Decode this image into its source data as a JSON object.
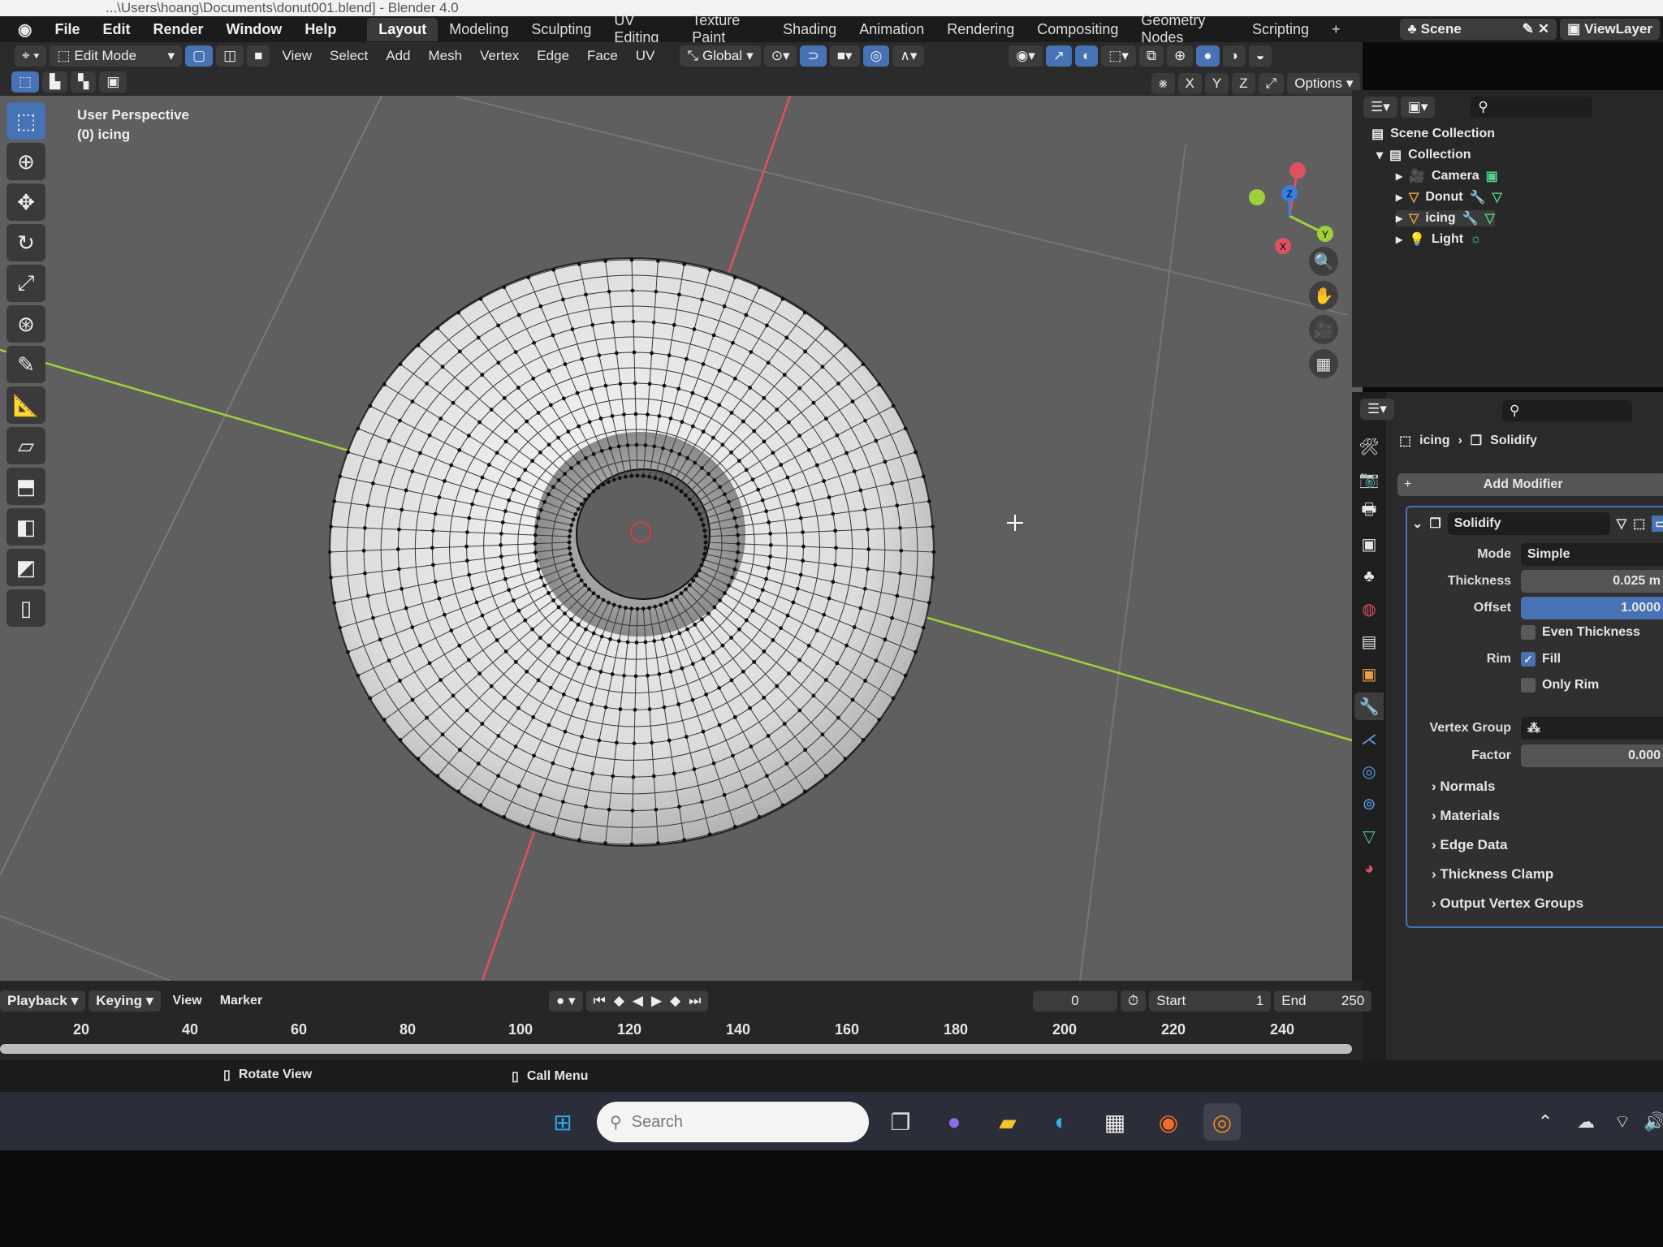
{
  "window": {
    "title": "...\\Users\\hoang\\Documents\\donut001.blend] - Blender 4.0"
  },
  "menubar": {
    "items": [
      "File",
      "Edit",
      "Render",
      "Window",
      "Help"
    ],
    "workspaces": [
      "Layout",
      "Modeling",
      "Sculpting",
      "UV Editing",
      "Texture Paint",
      "Shading",
      "Animation",
      "Rendering",
      "Compositing",
      "Geometry Nodes",
      "Scripting",
      "+"
    ],
    "active_workspace": "Layout",
    "scene": "Scene",
    "view_layer": "ViewLayer"
  },
  "header": {
    "mode": "Edit Mode",
    "menus": [
      "View",
      "Select",
      "Add",
      "Mesh",
      "Vertex",
      "Edge",
      "Face",
      "UV"
    ],
    "orientation": "Global",
    "axes": [
      "X",
      "Y",
      "Z"
    ],
    "options": "Options"
  },
  "viewport": {
    "view_name": "User Perspective",
    "object_label": "(0) icing",
    "gizmo_axes": [
      "X",
      "Y",
      "Z"
    ],
    "colors": {
      "x_axis": "#e05060",
      "y_axis": "#9fd03a",
      "z_axis": "#3a7ce0",
      "selection": "#4772b3"
    }
  },
  "outliner": {
    "root": "Scene Collection",
    "collection": "Collection",
    "items": [
      {
        "name": "Camera",
        "icon": "camera-icon"
      },
      {
        "name": "Donut",
        "icon": "mesh-icon"
      },
      {
        "name": "icing",
        "icon": "mesh-icon"
      },
      {
        "name": "Light",
        "icon": "light-icon"
      }
    ]
  },
  "properties": {
    "breadcrumb": {
      "object": "icing",
      "modifier": "Solidify"
    },
    "add_modifier": "Add Modifier",
    "modifier": {
      "name": "Solidify",
      "mode_label": "Mode",
      "mode": "Simple",
      "thickness_label": "Thickness",
      "thickness": "0.025 m",
      "offset_label": "Offset",
      "offset": "1.0000",
      "even_thickness": {
        "label": "Even Thickness",
        "checked": false
      },
      "rim_label": "Rim",
      "fill": {
        "label": "Fill",
        "checked": true
      },
      "only_rim": {
        "label": "Only Rim",
        "checked": false
      },
      "vertex_group_label": "Vertex Group",
      "factor_label": "Factor",
      "factor": "0.000",
      "subpanels": [
        "Normals",
        "Materials",
        "Edge Data",
        "Thickness Clamp",
        "Output Vertex Groups"
      ]
    }
  },
  "timeline": {
    "menus": [
      "Playback",
      "Keying",
      "View",
      "Marker"
    ],
    "current_frame": "0",
    "start_label": "Start",
    "start": "1",
    "end_label": "End",
    "end": "250",
    "ticks": [
      "20",
      "40",
      "60",
      "80",
      "100",
      "120",
      "140",
      "160",
      "180",
      "200",
      "220",
      "240"
    ]
  },
  "statusbar": {
    "hints": [
      "Rotate View",
      "Call Menu"
    ]
  },
  "taskbar": {
    "search_placeholder": "Search"
  }
}
